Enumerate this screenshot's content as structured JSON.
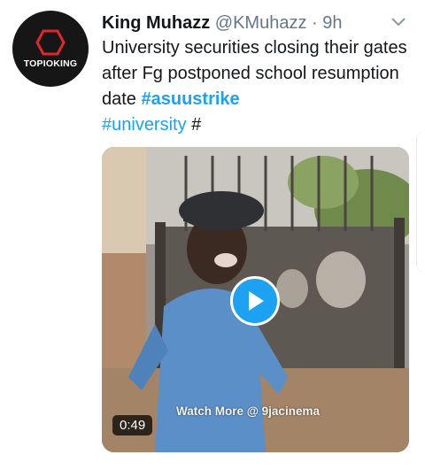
{
  "tweet": {
    "avatar": {
      "logo_text": "TOPIOKING",
      "icon": "hexagon-logo-icon"
    },
    "author": {
      "display_name": "King Muhazz",
      "handle": "@KMuhazz",
      "separator": "·",
      "time": "9h"
    },
    "menu_icon": "chevron-down-icon",
    "text": {
      "body": "University securities closing their gates after Fg postponed school resumption date ",
      "hashtag_1": "#asuustrike",
      "hashtag_2": "#university",
      "trailing": " #"
    },
    "media": {
      "type": "video",
      "watermark": "Watch More @ 9jacinema",
      "duration": "0:49",
      "play_icon": "play-icon"
    }
  },
  "colors": {
    "link": "#1da1f2",
    "text": "#14171a",
    "secondary": "#657786"
  }
}
